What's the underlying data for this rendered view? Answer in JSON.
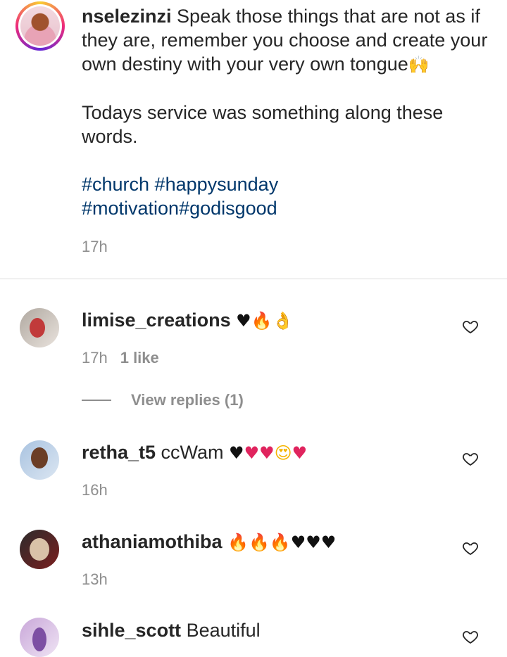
{
  "post": {
    "username": "nselezinzi",
    "caption_line1": " Speak those things that are not as if they are, remember you choose and create your own destiny with your very own tongue",
    "caption_emoji": "🙌",
    "caption_line2": "Todays service was something along these words.",
    "hashtags_line1": "#church #happysunday",
    "hashtags_line2": "#motivation#godisgood",
    "time": "17h"
  },
  "comments": [
    {
      "username": "limise_creations",
      "text": "",
      "emojis": [
        {
          "glyph": "♥",
          "kind": "black"
        },
        {
          "glyph": "🔥",
          "kind": "fire"
        },
        {
          "glyph": "👌",
          "kind": "hand"
        }
      ],
      "time": "17h",
      "likes": "1 like",
      "view_replies": "View replies (1)"
    },
    {
      "username": "retha_t5",
      "text": " ccWam ",
      "emojis": [
        {
          "glyph": "♥",
          "kind": "black"
        },
        {
          "glyph": "♥",
          "kind": "red"
        },
        {
          "glyph": "♥",
          "kind": "red"
        },
        {
          "glyph": "😍",
          "kind": "face"
        },
        {
          "glyph": "♥",
          "kind": "red"
        }
      ],
      "time": "16h"
    },
    {
      "username": "athaniamothiba",
      "text": " ",
      "emojis": [
        {
          "glyph": "🔥",
          "kind": "fire"
        },
        {
          "glyph": "🔥",
          "kind": "fire"
        },
        {
          "glyph": "🔥",
          "kind": "fire"
        },
        {
          "glyph": "♥",
          "kind": "black"
        },
        {
          "glyph": "♥",
          "kind": "black"
        },
        {
          "glyph": "♥",
          "kind": "black"
        }
      ],
      "time": "13h"
    },
    {
      "username": "sihle_scott",
      "text": " Beautiful",
      "emojis": []
    }
  ],
  "icons": {
    "like": "heart-outline-icon"
  },
  "colors": {
    "hashtag": "#00376b",
    "secondary_text": "#8e8e8e",
    "divider": "#dbdbdb"
  }
}
